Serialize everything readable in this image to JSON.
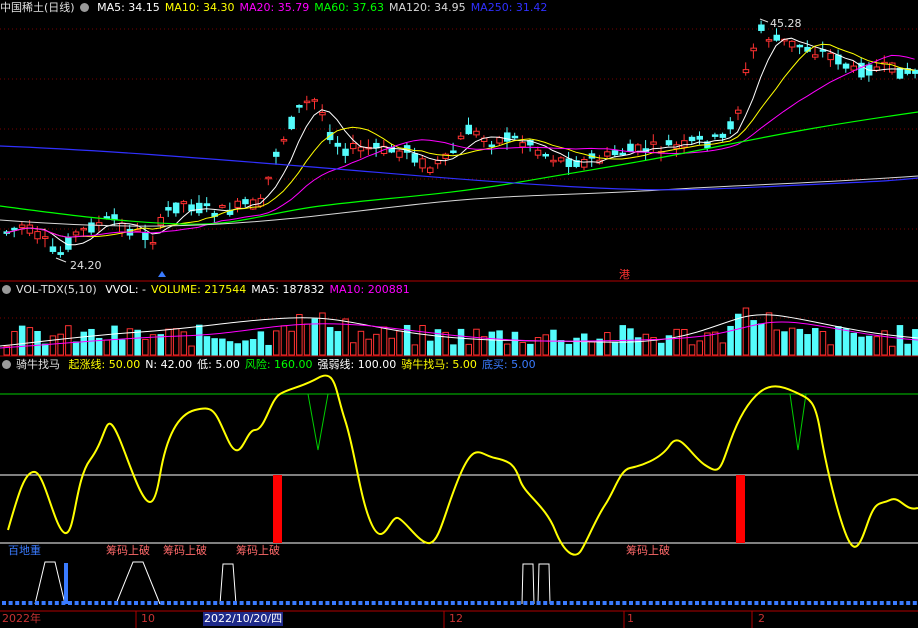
{
  "main": {
    "title": "中国稀土(日线)",
    "ma": [
      {
        "label": "MA5: 34.15",
        "color": "#ffffff"
      },
      {
        "label": "MA10: 34.30",
        "color": "#ffff00"
      },
      {
        "label": "MA20: 35.79",
        "color": "#ff00ff"
      },
      {
        "label": "MA60: 37.63",
        "color": "#00ff00"
      },
      {
        "label": "MA120: 34.95",
        "color": "#d8d8d8"
      },
      {
        "label": "MA250: 31.42",
        "color": "#3030ff"
      }
    ],
    "high_label": "45.28",
    "low_label": "24.20",
    "tag": "港"
  },
  "vol": {
    "title": "VOL-TDX(5,10)",
    "items": [
      {
        "label": "VVOL: -",
        "color": "#ffffff"
      },
      {
        "label": "VOLUME: 217544",
        "color": "#ffff00"
      },
      {
        "label": "MA5: 187832",
        "color": "#ffffff"
      },
      {
        "label": "MA10: 200881",
        "color": "#ff00ff"
      }
    ]
  },
  "ind": {
    "title": "骑牛找马",
    "items": [
      {
        "label": "起涨线: 50.00",
        "color": "#ffff00"
      },
      {
        "label": "N: 42.00",
        "color": "#ffffff"
      },
      {
        "label": "低: 5.00",
        "color": "#ffffff"
      },
      {
        "label": "风险: 160.00",
        "color": "#00ff00"
      },
      {
        "label": "强弱线: 100.00",
        "color": "#ffffff"
      },
      {
        "label": "骑牛找马: 5.00",
        "color": "#ffff00"
      },
      {
        "label": "底买: 5.00",
        "color": "#3a7bff"
      }
    ],
    "signals": [
      "百地重",
      "筹码上破",
      "筹码上破",
      "筹码上破",
      "筹码上破"
    ]
  },
  "xaxis": {
    "labels": [
      "2022年",
      "10",
      "2022/10/20/四",
      "12",
      "1",
      "2"
    ]
  },
  "colors": {
    "up": "#ff3232",
    "down": "#54fcfc",
    "bg": "#000000",
    "grid": "#b00000"
  }
}
